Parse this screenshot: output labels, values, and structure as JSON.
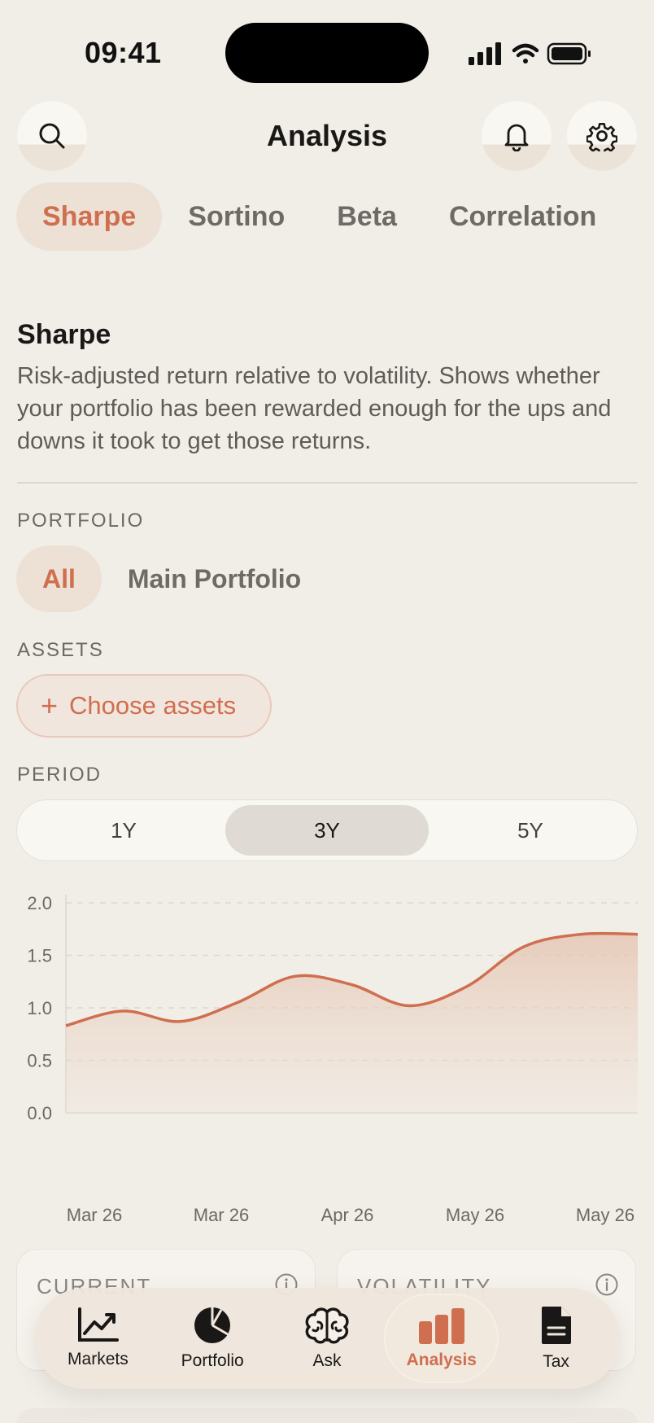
{
  "status_bar": {
    "time": "09:41"
  },
  "header": {
    "title": "Analysis"
  },
  "metric_tabs": [
    {
      "label": "Sharpe",
      "active": true
    },
    {
      "label": "Sortino",
      "active": false
    },
    {
      "label": "Beta",
      "active": false
    },
    {
      "label": "Correlation",
      "active": false
    }
  ],
  "section": {
    "title": "Sharpe",
    "description": "Risk-adjusted return relative to volatility. Shows whether your portfolio has been rewarded enough for the ups and downs it took to get those returns."
  },
  "portfolio": {
    "label": "PORTFOLIO",
    "options": [
      {
        "label": "All",
        "active": true
      },
      {
        "label": "Main Portfolio",
        "active": false
      }
    ]
  },
  "assets": {
    "label": "ASSETS",
    "button_label": "Choose assets"
  },
  "period": {
    "label": "PERIOD",
    "options": [
      {
        "label": "1Y",
        "active": false
      },
      {
        "label": "3Y",
        "active": true
      },
      {
        "label": "5Y",
        "active": false
      }
    ]
  },
  "chart_data": {
    "type": "area",
    "x": [
      0,
      0.5,
      1,
      1.5,
      2,
      2.5,
      3,
      3.5,
      4,
      4.5,
      5
    ],
    "values": [
      0.83,
      0.97,
      0.87,
      1.05,
      1.3,
      1.22,
      1.02,
      1.2,
      1.58,
      1.7,
      1.7
    ],
    "yticks": [
      "2.0",
      "1.5",
      "1.0",
      "0.5",
      "0.0"
    ],
    "ylim": [
      0,
      2
    ],
    "xtick_labels": [
      "Mar 26",
      "Mar 26",
      "Apr 26",
      "May 26",
      "May 26"
    ],
    "grid": true,
    "color": "#cf6f4f"
  },
  "stats": [
    {
      "label": "CURRENT"
    },
    {
      "label": "VOLATILITY"
    }
  ],
  "tab_bar": [
    {
      "label": "Markets",
      "icon": "markets-chart-icon",
      "active": false
    },
    {
      "label": "Portfolio",
      "icon": "pie-chart-icon",
      "active": false
    },
    {
      "label": "Ask",
      "icon": "brain-icon",
      "active": false
    },
    {
      "label": "Analysis",
      "icon": "bar-chart-icon",
      "active": true
    },
    {
      "label": "Tax",
      "icon": "document-icon",
      "active": false
    }
  ],
  "colors": {
    "accent": "#cf6f4f",
    "background": "#f1eee8",
    "chip_active": "#ede1d6"
  }
}
